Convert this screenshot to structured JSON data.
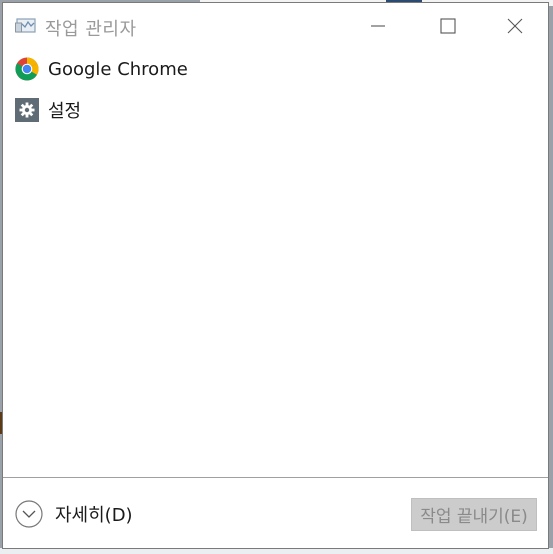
{
  "window": {
    "title": "작업 관리자"
  },
  "apps": [
    {
      "label": "Google Chrome",
      "icon": "chrome-icon"
    },
    {
      "label": "설정",
      "icon": "settings-gear-icon"
    }
  ],
  "footer": {
    "details_label": "자세히(D)",
    "end_task_label": "작업 끝내기(E)"
  },
  "colors": {
    "title_text": "#9a9a9a",
    "end_task_disabled_bg": "#cccccc",
    "settings_icon_bg": "#5f6b75"
  }
}
